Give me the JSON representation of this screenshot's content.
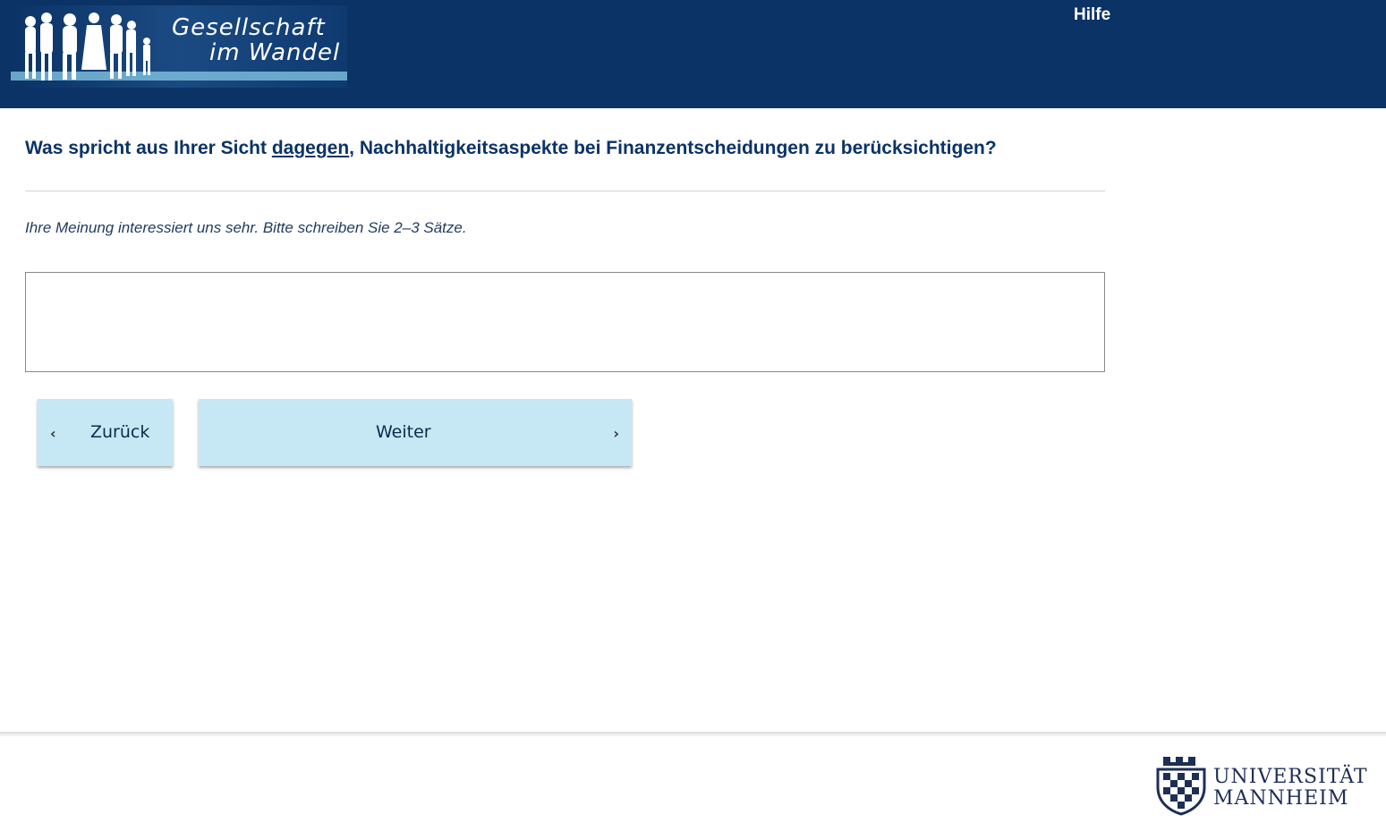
{
  "header": {
    "logo_line1": "Gesellschaft",
    "logo_line2": "im Wandel",
    "help_label": "Hilfe"
  },
  "question": {
    "before": "Was spricht aus Ihrer Sicht ",
    "emphasis": "dagegen",
    "after": ", Nachhaltigkeitsaspekte bei Finanzentscheidungen zu berücksichtigen?"
  },
  "instruction": "Ihre Meinung interessiert uns sehr. Bitte schreiben Sie 2–3 Sätze.",
  "answer": {
    "value": ""
  },
  "navigation": {
    "back_label": "Zurück",
    "next_label": "Weiter"
  },
  "footer": {
    "university_line1": "UNIVERSITÄT",
    "university_line2": "MANNHEIM"
  },
  "colors": {
    "header_bg": "#0b3366",
    "button_bg": "#c6e8f5",
    "question_text": "#0b3366"
  }
}
